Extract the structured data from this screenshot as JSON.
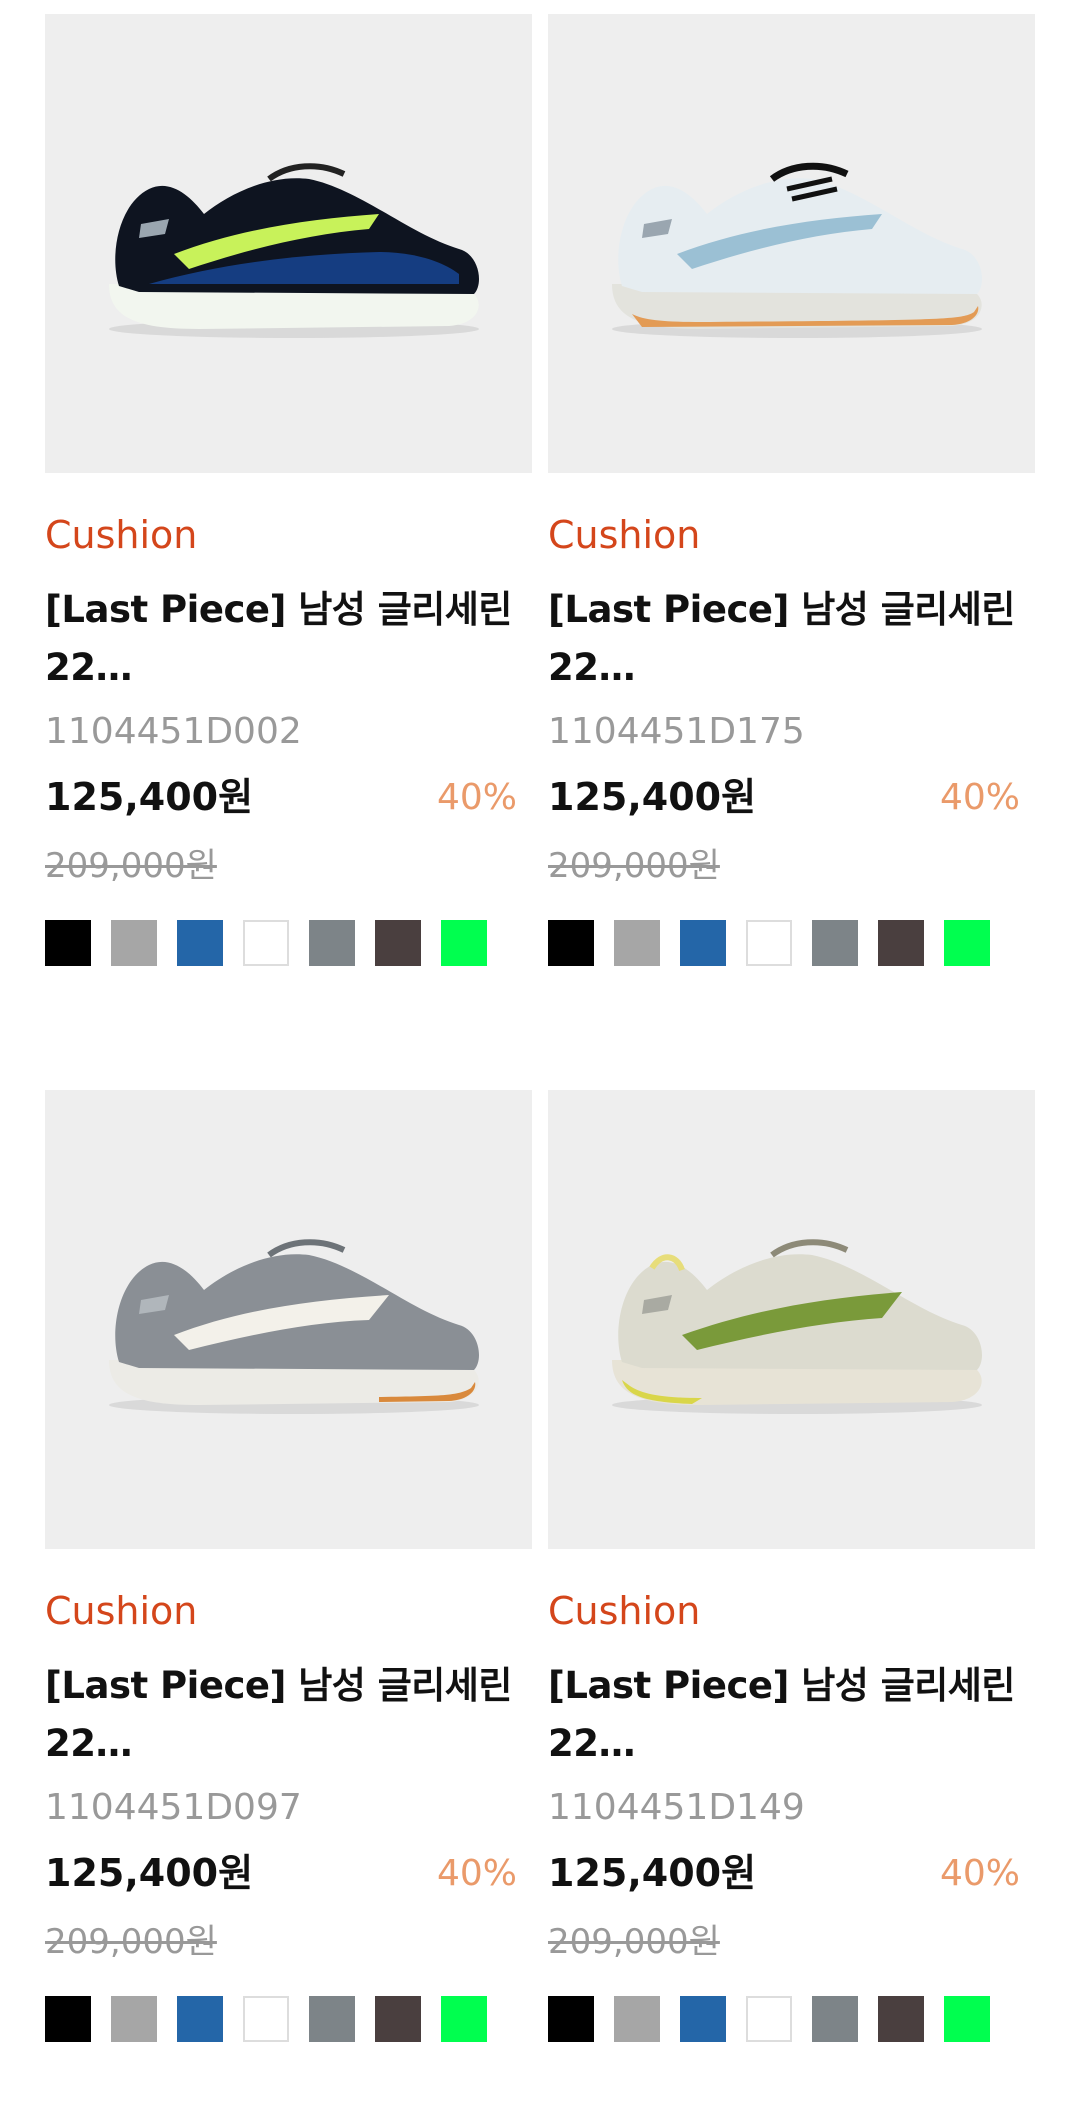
{
  "products": [
    {
      "category": "Cushion",
      "name_line1": "[Last Piece] 남성 글리세린",
      "name_line2": "22…",
      "code": "1104451D002",
      "price": "125,400원",
      "discount": "40%",
      "original_price": "209,000원",
      "image_colors": {
        "upper": "#0e1420",
        "accent": "#1b5fd1",
        "stripe": "#c8f25a",
        "sole": "#f2f6ef"
      }
    },
    {
      "category": "Cushion",
      "name_line1": "[Last Piece] 남성 글리세린",
      "name_line2": "22…",
      "code": "1104451D175",
      "price": "125,400원",
      "discount": "40%",
      "original_price": "209,000원",
      "image_colors": {
        "upper": "#e6edf1",
        "accent": "#9bc0d4",
        "stripe": "#9bc0d4",
        "sole": "#e3e3dd"
      }
    },
    {
      "category": "Cushion",
      "name_line1": "[Last Piece] 남성 글리세린",
      "name_line2": "22…",
      "code": "1104451D097",
      "price": "125,400원",
      "discount": "40%",
      "original_price": "209,000원",
      "image_colors": {
        "upper": "#8a8f95",
        "accent": "#f3f1ea",
        "stripe": "#e98a3a",
        "sole": "#ecebe6"
      }
    },
    {
      "category": "Cushion",
      "name_line1": "[Last Piece] 남성 글리세린",
      "name_line2": "22…",
      "code": "1104451D149",
      "price": "125,400원",
      "discount": "40%",
      "original_price": "209,000원",
      "image_colors": {
        "upper": "#dcdbcf",
        "accent": "#7a9a3a",
        "stripe": "#7a9a3a",
        "sole": "#e7e3d6"
      }
    }
  ],
  "swatch_colors": [
    {
      "name": "black",
      "hex": "#000000"
    },
    {
      "name": "light-gray",
      "hex": "#a6a6a6"
    },
    {
      "name": "blue",
      "hex": "#2466a8"
    },
    {
      "name": "white",
      "hex": "#ffffff"
    },
    {
      "name": "gray",
      "hex": "#7d8488"
    },
    {
      "name": "dark-brown",
      "hex": "#4a3f3f"
    },
    {
      "name": "green",
      "hex": "#00ff4f"
    }
  ],
  "colors": {
    "category": "#d4461b",
    "discount": "#ea9a6a",
    "muted_text": "#999999",
    "image_bg": "#eeeeee"
  }
}
